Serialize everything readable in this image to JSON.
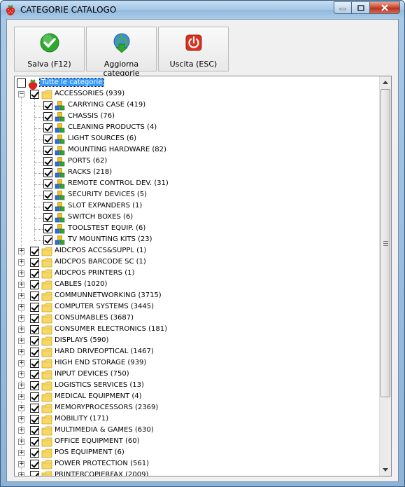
{
  "window": {
    "title": "CATEGORIE CATALOGO"
  },
  "toolbar": {
    "save_label": "Salva (F12)",
    "update_label": "Aggiorna categorie",
    "exit_label": "Uscita (ESC)"
  },
  "tree": {
    "root": {
      "label": "Tutte le categorie",
      "checked": false,
      "expanded": true
    },
    "expanded_category": {
      "label": "ACCESSORIES (939)",
      "checked": true,
      "children": [
        "CARRYING CASE (419)",
        "CHASSIS (76)",
        "CLEANING PRODUCTS (4)",
        "LIGHT SOURCES (6)",
        "MOUNTING HARDWARE (82)",
        "PORTS (62)",
        "RACKS (218)",
        "REMOTE CONTROL DEV. (31)",
        "SECURITY DEVICES (5)",
        "SLOT EXPANDERS (1)",
        "SWITCH BOXES (6)",
        "TOOLSTEST EQUIP. (6)",
        "TV MOUNTING KITS (23)"
      ]
    },
    "categories": [
      "AIDCPOS ACCS&SUPPL (1)",
      "AIDCPOS BARCODE SC (1)",
      "AIDCPOS PRINTERS (1)",
      "CABLES (1020)",
      "COMMUNNETWORKING (3715)",
      "COMPUTER SYSTEMS (3445)",
      "CONSUMABLES (3687)",
      "CONSUMER ELECTRONICS (181)",
      "DISPLAYS (590)",
      "HARD DRIVEOPTICAL (1467)",
      "HIGH END STORAGE (939)",
      "INPUT DEVICES (750)",
      "LOGISTICS SERVICES (13)",
      "MEDICAL EQUIPMENT (4)",
      "MEMORYPROCESSORS (2369)",
      "MOBILITY (171)",
      "MULTIMEDIA & GAMES (630)",
      "OFFICE EQUIPMENT (60)",
      "POS EQUIPMENT (6)",
      "POWER PROTECTION (561)",
      "PRINTERCOPIERFAX (2009)"
    ]
  },
  "icons": {
    "app": "strawberry-icon",
    "save": "green-check-icon",
    "update": "globe-down-arrow-icon",
    "exit": "power-icon",
    "folder": "folder-icon",
    "subcategory": "cubes-icon"
  },
  "colors": {
    "selection": "#3399ff",
    "save_green": "#2fa82f",
    "exit_red": "#d8321e",
    "folder_yellow": "#f7d865"
  }
}
